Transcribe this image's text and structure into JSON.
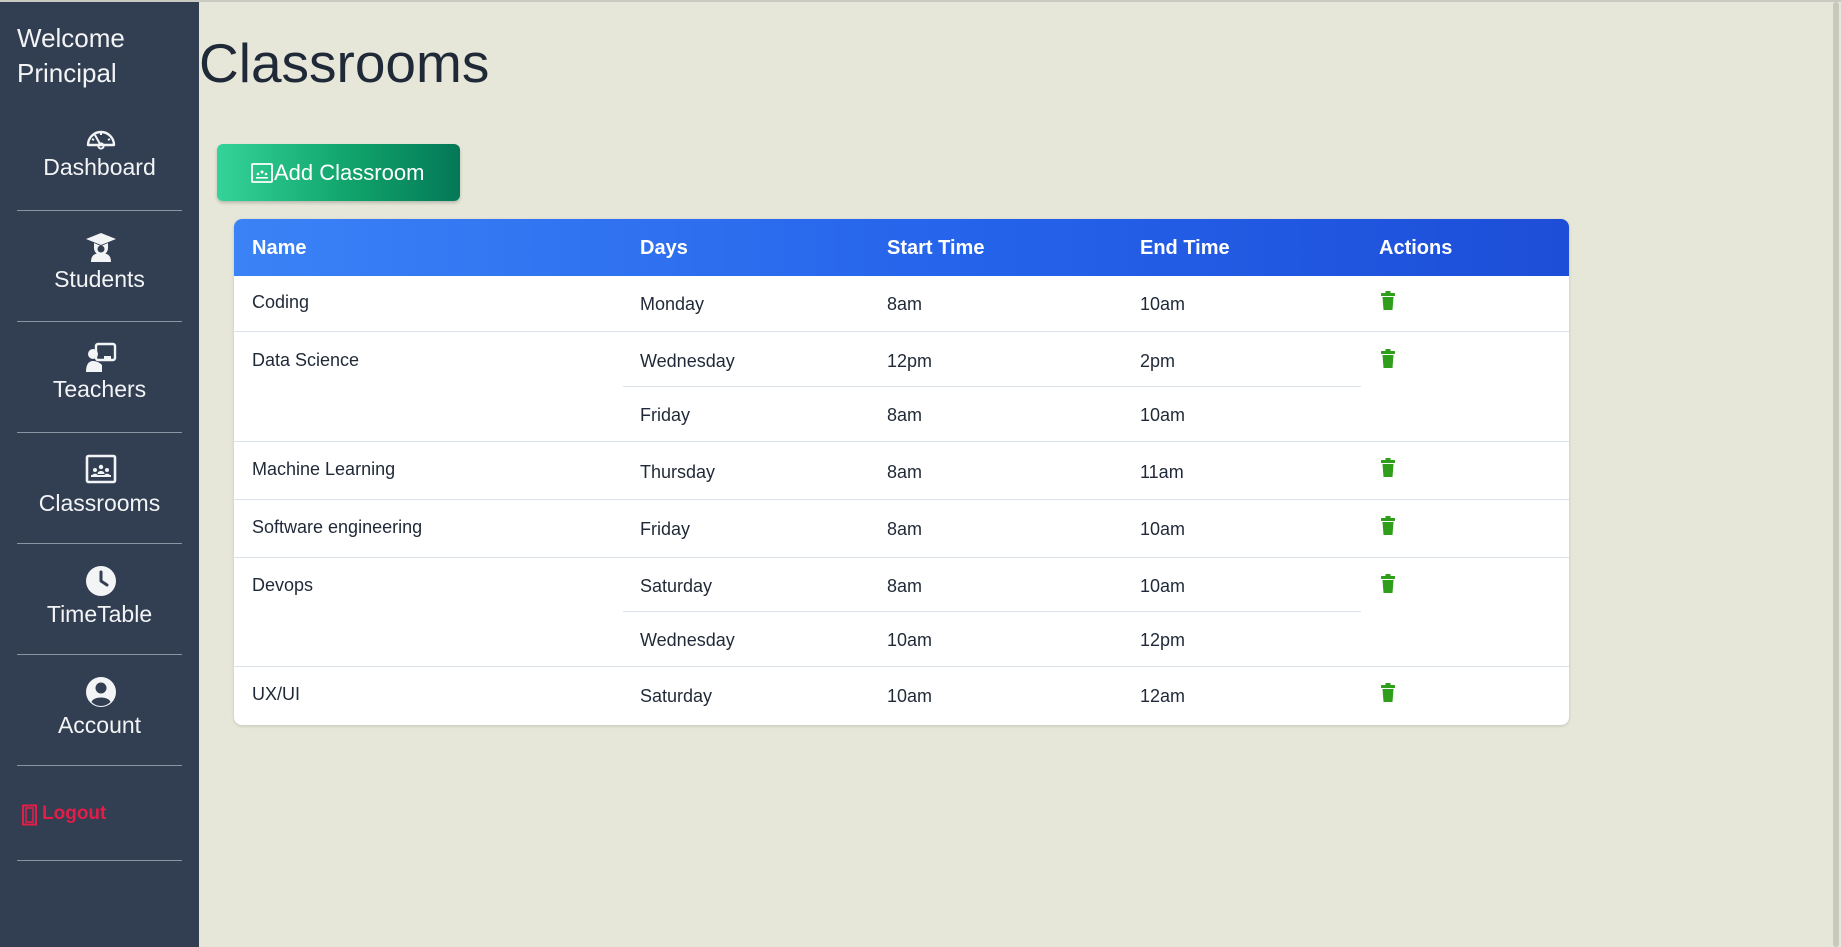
{
  "sidebar": {
    "welcome": "Welcome Principal",
    "items": [
      {
        "label": "Dashboard",
        "icon": "gauge-icon"
      },
      {
        "label": "Students",
        "icon": "graduation-cap-icon"
      },
      {
        "label": "Teachers",
        "icon": "chalkboard-teacher-icon"
      },
      {
        "label": "Classrooms",
        "icon": "chalkboard-icon"
      },
      {
        "label": "TimeTable",
        "icon": "clock-icon"
      },
      {
        "label": "Account",
        "icon": "user-circle-icon"
      }
    ],
    "logout": "Logout"
  },
  "main": {
    "title": "Classrooms",
    "add_button": "Add Classroom"
  },
  "table": {
    "headers": [
      "Name",
      "Days",
      "Start Time",
      "End Time",
      "Actions"
    ],
    "rows": [
      {
        "name": "Coding",
        "sessions": [
          {
            "day": "Monday",
            "start": "8am",
            "end": "10am"
          }
        ]
      },
      {
        "name": "Data Science",
        "sessions": [
          {
            "day": "Wednesday",
            "start": "12pm",
            "end": "2pm"
          },
          {
            "day": "Friday",
            "start": "8am",
            "end": "10am"
          }
        ]
      },
      {
        "name": "Machine Learning",
        "sessions": [
          {
            "day": "Thursday",
            "start": "8am",
            "end": "11am"
          }
        ]
      },
      {
        "name": "Software engineering",
        "sessions": [
          {
            "day": "Friday",
            "start": "8am",
            "end": "10am"
          }
        ]
      },
      {
        "name": "Devops",
        "sessions": [
          {
            "day": "Saturday",
            "start": "8am",
            "end": "10am"
          },
          {
            "day": "Wednesday",
            "start": "10am",
            "end": "12pm"
          }
        ]
      },
      {
        "name": "UX/UI",
        "sessions": [
          {
            "day": "Saturday",
            "start": "10am",
            "end": "12am"
          }
        ]
      }
    ]
  },
  "colors": {
    "sidebar_bg": "#323e51",
    "page_bg": "#e6e7d8",
    "header_gradient": [
      "#3b82f6",
      "#1d4ed8"
    ],
    "button_gradient": [
      "#34d399",
      "#047857"
    ],
    "trash": "#2f9e1a",
    "logout": "#e11d48"
  }
}
